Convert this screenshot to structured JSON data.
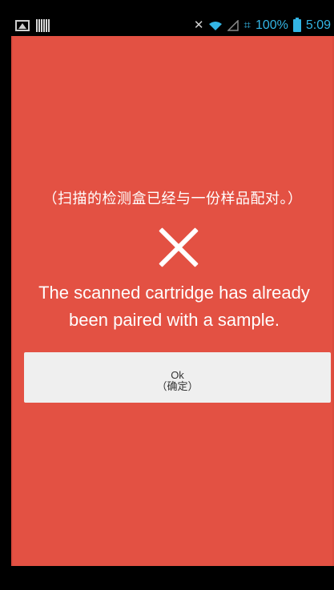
{
  "status_bar": {
    "left_icons": [
      "image-icon",
      "barcode-icon"
    ],
    "right_icons": [
      "mute-icon",
      "wifi-icon",
      "signal-icon",
      "network-icon",
      "battery-icon"
    ],
    "battery": "100%",
    "time": "5:09"
  },
  "dialog": {
    "chinese_message": "（扫描的检测盒已经与一份样品配对。）",
    "english_message_line1": "The scanned cartridge has already",
    "english_message_line2": "been paired with a sample.",
    "button_label_en": "Ok",
    "button_label_cn": "（确定）"
  },
  "colors": {
    "background": "#e35143",
    "status_accent": "#33b5e5",
    "button_bg": "#efefef",
    "text": "#ffffff"
  }
}
